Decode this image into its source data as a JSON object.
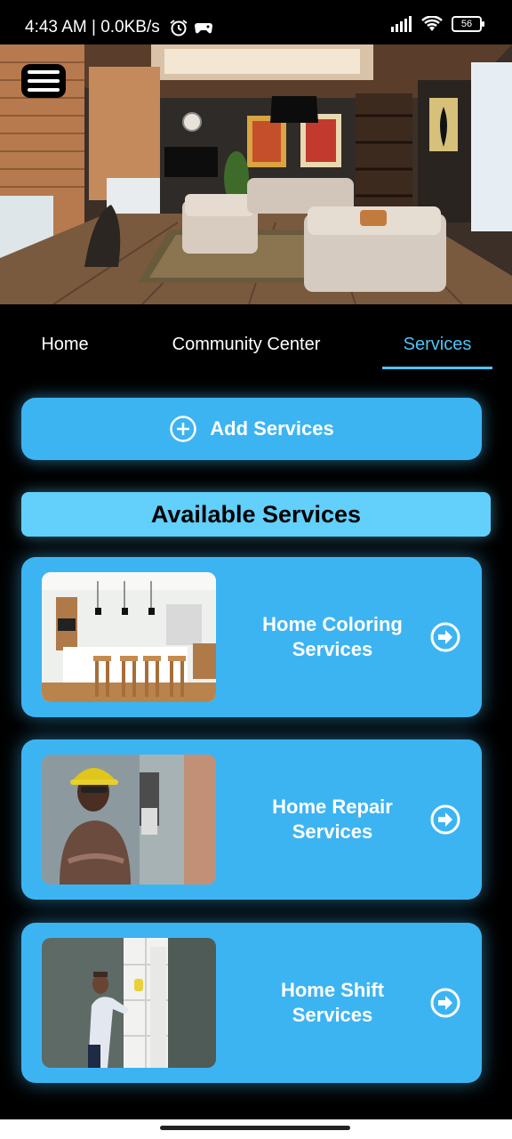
{
  "status_bar": {
    "time_speed": "4:43 AM | 0.0KB/s",
    "battery": "56",
    "icons": [
      "alarm-icon",
      "game-controller-icon",
      "signal-icon",
      "wifi-icon",
      "battery-icon"
    ]
  },
  "hero": {
    "image": "living-room-photo"
  },
  "tabs": [
    {
      "label": "Home"
    },
    {
      "label": "Community Center"
    },
    {
      "label": "Services",
      "active": true
    }
  ],
  "add_services": {
    "label": "Add Services"
  },
  "available": {
    "title": "Available Services"
  },
  "services": [
    {
      "title": "Home Coloring\nServices",
      "image": "kitchen-photo"
    },
    {
      "title": "Home Repair\nServices",
      "image": "repair-worker-photo"
    },
    {
      "title": "Home Shift\nServices",
      "image": "cleaning-photo"
    }
  ],
  "colors": {
    "accent": "#3db4f2",
    "header_bar": "#62d0fb",
    "tab_active": "#4fc3f7"
  }
}
